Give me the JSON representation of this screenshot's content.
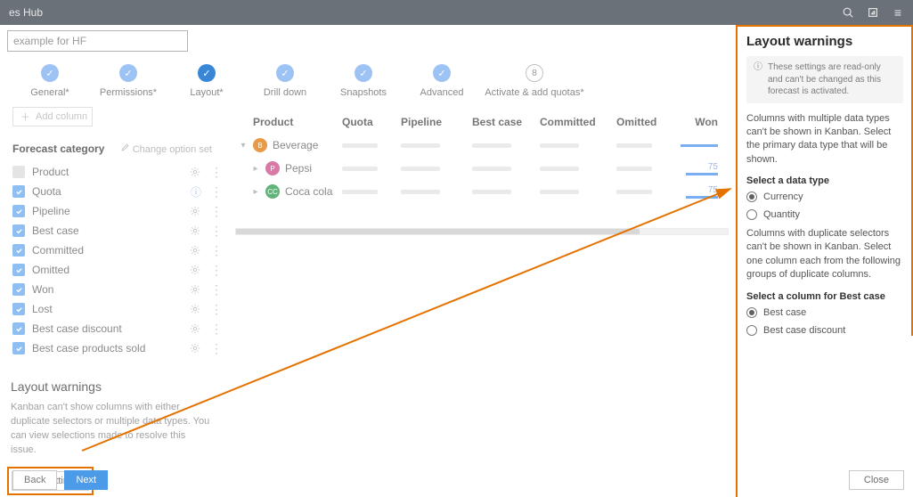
{
  "topbar": {
    "title": "es Hub"
  },
  "search_value": "example for HF",
  "steps": [
    {
      "label": "General*",
      "state": "done"
    },
    {
      "label": "Permissions*",
      "state": "done"
    },
    {
      "label": "Layout*",
      "state": "current"
    },
    {
      "label": "Drill down",
      "state": "done"
    },
    {
      "label": "Snapshots",
      "state": "done"
    },
    {
      "label": "Advanced",
      "state": "done"
    },
    {
      "label": "Activate & add quotas*",
      "state": "inactive",
      "num": "8"
    }
  ],
  "add_col_label": "Add column",
  "section": {
    "title": "Forecast category",
    "option": "Change option set"
  },
  "categories": [
    {
      "label": "Product",
      "checked": false
    },
    {
      "label": "Quota",
      "checked": true,
      "info": true
    },
    {
      "label": "Pipeline",
      "checked": true
    },
    {
      "label": "Best case",
      "checked": true
    },
    {
      "label": "Committed",
      "checked": true
    },
    {
      "label": "Omitted",
      "checked": true
    },
    {
      "label": "Won",
      "checked": true
    },
    {
      "label": "Lost",
      "checked": true
    },
    {
      "label": "Best case discount",
      "checked": true
    },
    {
      "label": "Best case products sold",
      "checked": true
    }
  ],
  "warning": {
    "title": "Layout warnings",
    "text": "Kanban can't show columns with either duplicate selectors or multiple data types. You can view selections made to resolve this issue.",
    "button": "View settings"
  },
  "footer": {
    "back": "Back",
    "next": "Next"
  },
  "table": {
    "headers": {
      "product": "Product",
      "quota": "Quota",
      "pipeline": "Pipeline",
      "best": "Best case",
      "committed": "Committed",
      "omitted": "Omitted",
      "won": "Won"
    },
    "rows": [
      {
        "name": "Beverage",
        "avatar": "B",
        "avclass": "b",
        "arrow": "▾",
        "num": ""
      },
      {
        "name": "Pepsi",
        "avatar": "P",
        "avclass": "p",
        "arrow": "▸",
        "num": "75",
        "indent": true
      },
      {
        "name": "Coca cola",
        "avatar": "CC",
        "avclass": "cc",
        "arrow": "▸",
        "num": "75",
        "indent": true
      }
    ]
  },
  "panel": {
    "title": "Layout warnings",
    "info": "These settings are read-only and can't be changed as this forecast is activated.",
    "p1": "Columns with multiple data types can't be shown in Kanban. Select the primary data type that will be shown.",
    "h1": "Select a data type",
    "r1a": "Currency",
    "r1b": "Quantity",
    "p2": "Columns with duplicate selectors can't be shown in Kanban. Select one column each from the following groups of duplicate columns.",
    "h2": "Select a column for Best case",
    "r2a": "Best case",
    "r2b": "Best case discount",
    "close": "Close"
  }
}
